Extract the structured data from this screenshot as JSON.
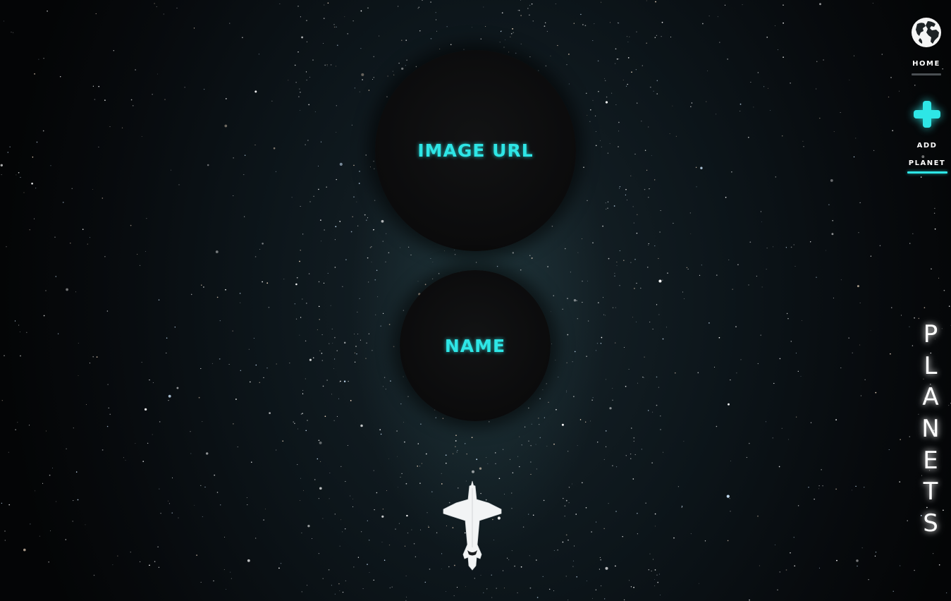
{
  "form": {
    "image_url_placeholder": "IMAGE URL",
    "name_placeholder": "NAME"
  },
  "nav": {
    "home_label": "HOME",
    "add_planet_label_line1": "ADD",
    "add_planet_label_line2": "PLANET",
    "planets_title": [
      "P",
      "L",
      "A",
      "N",
      "E",
      "T",
      "S"
    ]
  },
  "icons": {
    "home": "globe-icon",
    "add_planet": "plus-icon",
    "launch": "space-shuttle-icon"
  },
  "colors": {
    "accent": "#2ee6e6",
    "text": "#ffffff",
    "orb": "#0b0b0c",
    "home_underline": "#4a4f53"
  }
}
